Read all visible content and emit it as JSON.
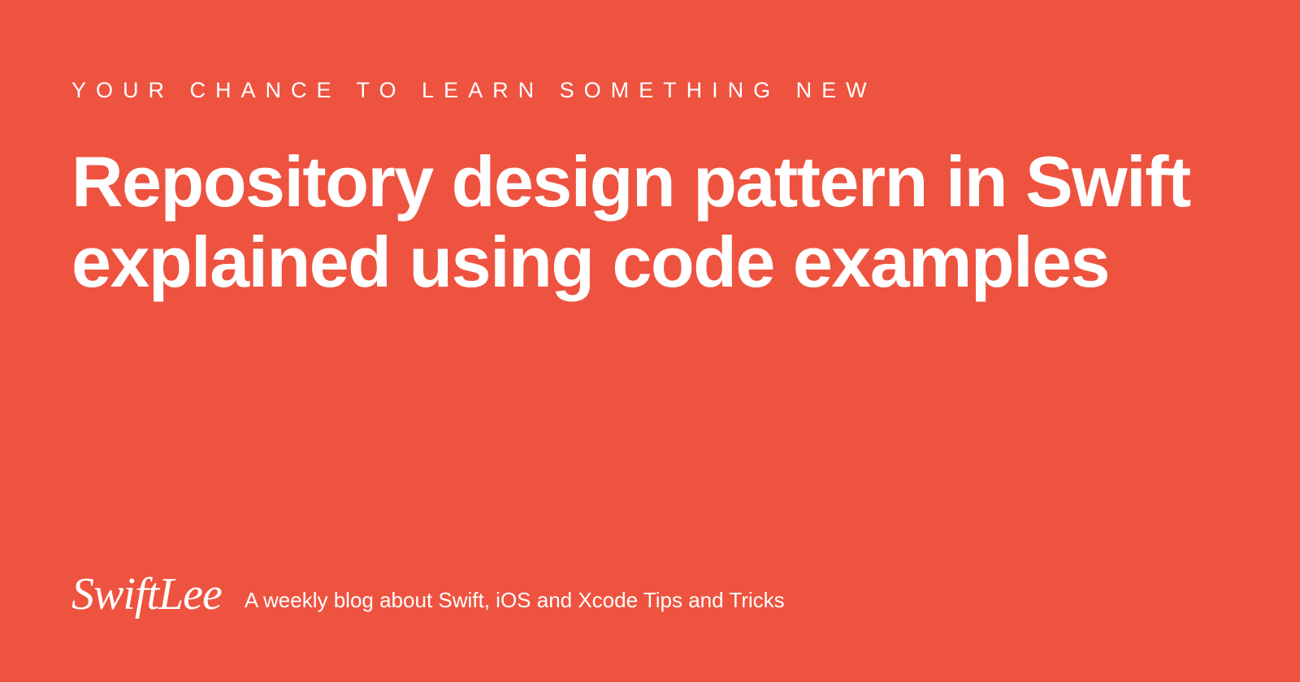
{
  "eyebrow": "YOUR CHANCE TO LEARN SOMETHING NEW",
  "title": "Repository design pattern in Swift explained using code examples",
  "logo": "SwiftLee",
  "tagline": "A weekly blog about Swift, iOS and Xcode Tips and Tricks"
}
